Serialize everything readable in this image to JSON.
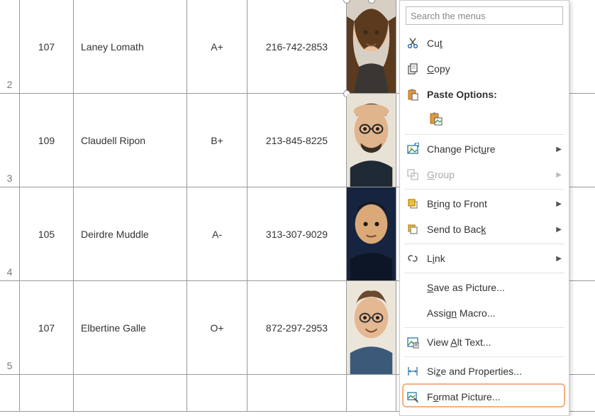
{
  "grid": {
    "row_headers": [
      "2",
      "3",
      "4",
      "5"
    ],
    "rows": [
      {
        "id": "107",
        "name": "Laney Lomath",
        "grade": "A+",
        "phone": "216-742-2853"
      },
      {
        "id": "109",
        "name": "Claudell Ripon",
        "grade": "B+",
        "phone": "213-845-8225"
      },
      {
        "id": "105",
        "name": "Deirdre Muddle",
        "grade": "A-",
        "phone": "313-307-9029"
      },
      {
        "id": "107",
        "name": "Elbertine Galle",
        "grade": "O+",
        "phone": "872-297-2953"
      }
    ]
  },
  "context_menu": {
    "search_placeholder": "Search the menus",
    "cut": "Cut",
    "copy": "Copy",
    "paste_options": "Paste Options:",
    "change_picture": "Change Picture",
    "group": "Group",
    "bring_to_front": "Bring to Front",
    "send_to_back": "Send to Back",
    "link": "Link",
    "save_as_picture": "Save as Picture...",
    "assign_macro": "Assign Macro...",
    "view_alt_text": "View Alt Text...",
    "size_and_properties": "Size and Properties...",
    "format_picture": "Format Picture..."
  },
  "underlines": {
    "cut": "t",
    "copy": "C",
    "change_picture": "u",
    "group": "G",
    "bring_to_front": "R",
    "send_to_back": "K",
    "link": "I",
    "save_as_picture": "S",
    "assign_macro": "N",
    "view_alt_text": "A",
    "size_and_properties": "z",
    "format_picture": "o"
  }
}
